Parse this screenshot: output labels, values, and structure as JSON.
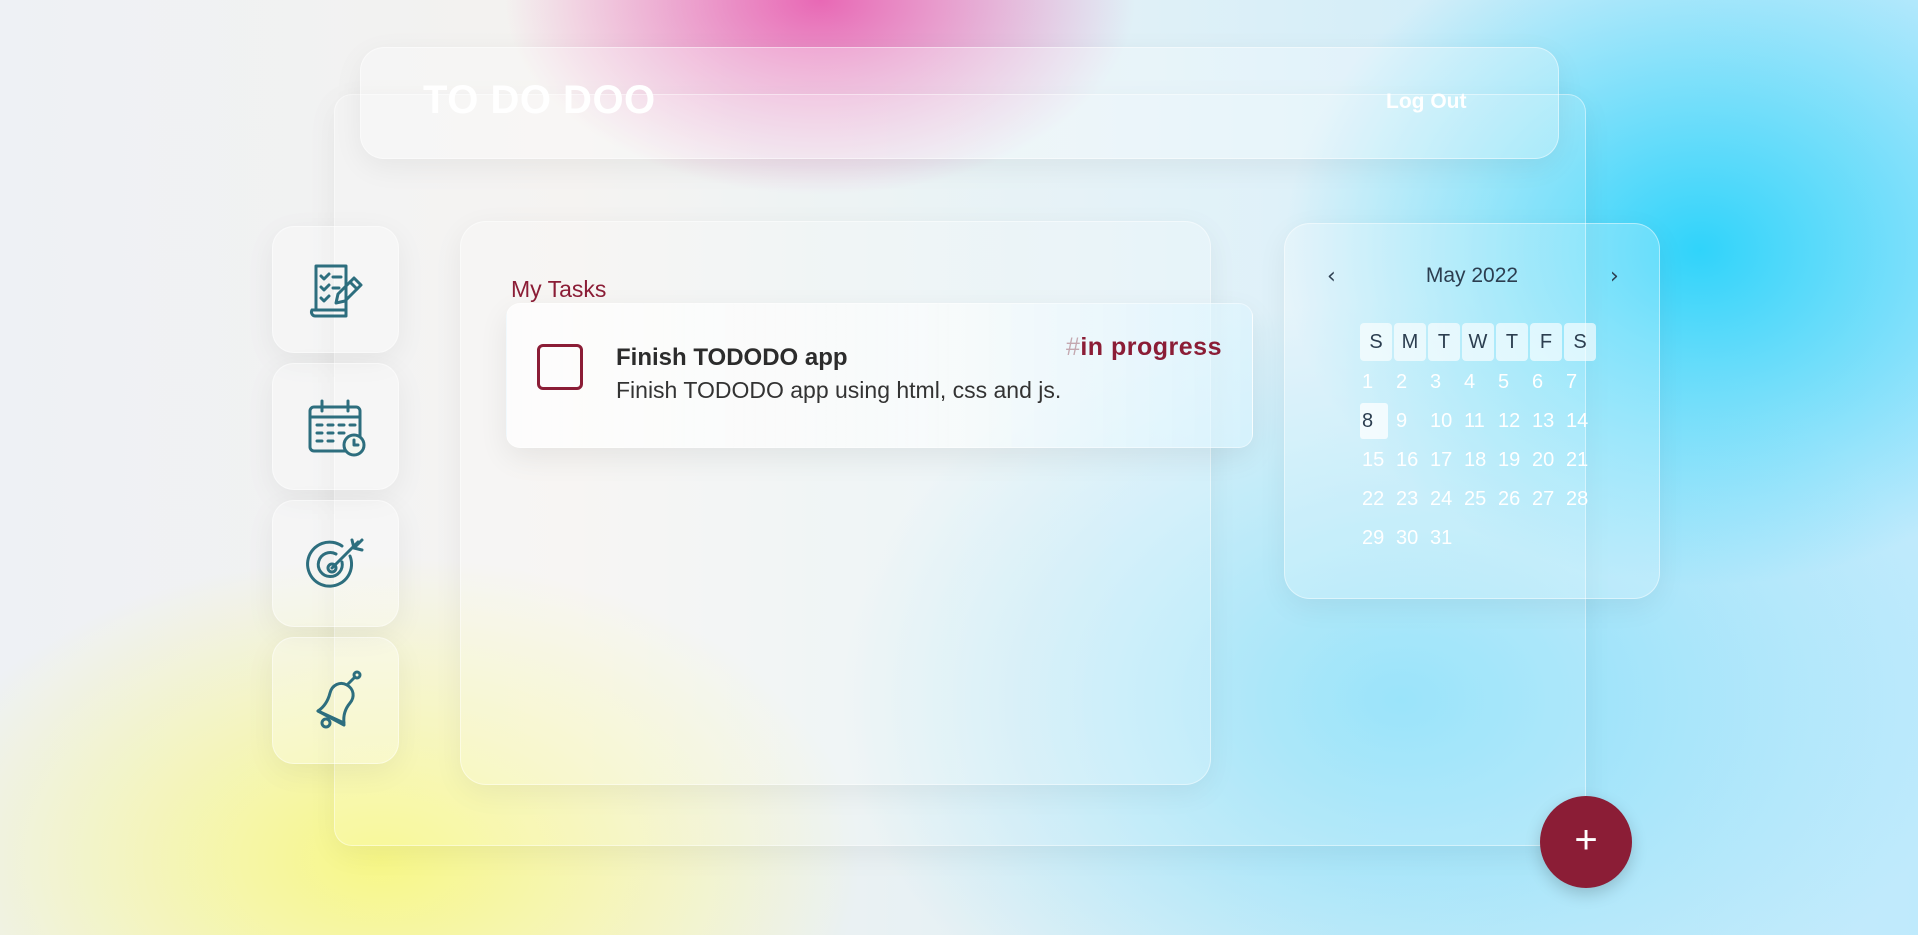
{
  "header": {
    "brand": "TO DO DOO",
    "logout_label": "Log Out"
  },
  "sidebar": {
    "items": [
      {
        "icon": "task-list-icon"
      },
      {
        "icon": "calendar-clock-icon"
      },
      {
        "icon": "target-icon"
      },
      {
        "icon": "bell-icon"
      }
    ]
  },
  "tasks": {
    "title": "My Tasks",
    "items": [
      {
        "title": "Finish TODODO app",
        "description": "Finish TODODO app using html, css and js.",
        "tag_hash": "#",
        "tag": "in progress",
        "done": false
      }
    ]
  },
  "calendar": {
    "prev": "‹",
    "next": "›",
    "month_label": "May 2022",
    "weekdays": [
      "S",
      "M",
      "T",
      "W",
      "T",
      "F",
      "S"
    ],
    "days": [
      "1",
      "2",
      "3",
      "4",
      "5",
      "6",
      "7",
      "8",
      "9",
      "10",
      "11",
      "12",
      "13",
      "14",
      "15",
      "16",
      "17",
      "18",
      "19",
      "20",
      "21",
      "22",
      "23",
      "24",
      "25",
      "26",
      "27",
      "28",
      "29",
      "30",
      "31"
    ],
    "today": "8"
  },
  "fab": {
    "label": "+"
  },
  "colors": {
    "accent": "#8b1d36",
    "icon": "#2d6e7e"
  }
}
